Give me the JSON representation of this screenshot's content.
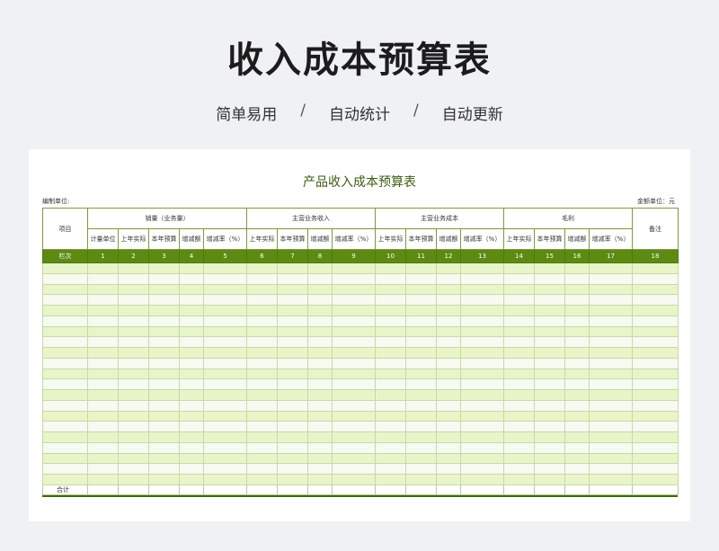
{
  "hero": {
    "title": "收入成本预算表",
    "features": [
      "简单易用",
      "自动统计",
      "自动更新"
    ],
    "separator": "/"
  },
  "sheet": {
    "title": "产品收入成本预算表",
    "left_meta": "编制单位:",
    "right_meta": "金额单位：元",
    "headers": {
      "item": "项目",
      "groups": [
        "销量（业务量）",
        "主营业务收入",
        "主营业务成本",
        "毛利"
      ],
      "remark": "备注",
      "sales_sub": [
        "计量单位",
        "上年实际",
        "本年预算",
        "增减额",
        "增减率（%）"
      ],
      "group_sub": [
        "上年实际",
        "本年预算",
        "增减额",
        "增减率（%）"
      ]
    },
    "index_row": [
      "栏次",
      "1",
      "2",
      "3",
      "4",
      "5",
      "6",
      "7",
      "8",
      "9",
      "10",
      "11",
      "12",
      "13",
      "14",
      "15",
      "16",
      "17",
      "18"
    ],
    "total_label": "合计"
  },
  "colors": {
    "title_green": "#3d5a12",
    "header_band": "#5d8a12",
    "row_light_green": "#e8f5c8"
  }
}
